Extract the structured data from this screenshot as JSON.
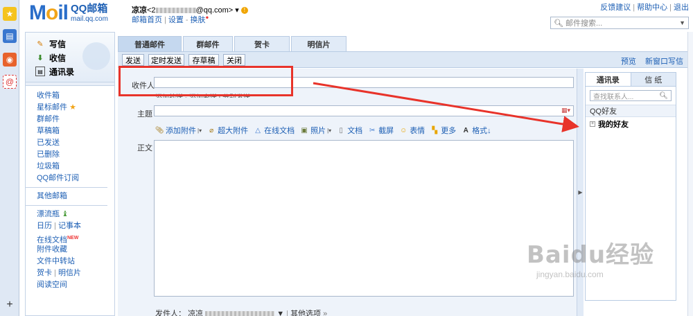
{
  "rail": {
    "icons": [
      "star-icon",
      "note-icon",
      "weibo-icon",
      "at-icon"
    ],
    "add_label": "+"
  },
  "header": {
    "logo_letters": [
      "M",
      "o",
      "il"
    ],
    "logo_cn": "QQ邮箱",
    "logo_url": "mail.qq.com",
    "user_name": "凉凉",
    "email_prefix": "<2",
    "email_suffix": "@qq.com>",
    "links": [
      "邮箱首页",
      "设置",
      "换肤"
    ],
    "top_links": [
      "反馈建议",
      "帮助中心",
      "退出"
    ],
    "search_placeholder": "邮件搜索..."
  },
  "leftnav": {
    "ops": [
      {
        "label": "写信",
        "icon": "pencil-icon"
      },
      {
        "label": "收信",
        "icon": "inbox-download-icon"
      },
      {
        "label": "通讯录",
        "icon": "address-book-icon"
      }
    ],
    "folders_group1": [
      "收件箱",
      "星标邮件",
      "群邮件",
      "草稿箱",
      "已发送",
      "已删除",
      "垃圾箱",
      "QQ邮件订阅"
    ],
    "folders_group2": [
      "其他邮箱"
    ],
    "folders_group3": [
      "漂流瓶",
      "日历",
      "记事本",
      "在线文档",
      "附件收藏",
      "文件中转站",
      "贺卡",
      "明信片",
      "阅读空间"
    ],
    "new_tag": "NEW"
  },
  "tabs": [
    "普通邮件",
    "群邮件",
    "贺卡",
    "明信片"
  ],
  "toolbar": {
    "buttons": [
      "发送",
      "定时发送",
      "存草稿",
      "关闭"
    ],
    "right_links": [
      "预览",
      "新窗口写信"
    ]
  },
  "compose": {
    "to_label": "收件人",
    "to_hint": "添加抄送 - 添加密送 | 分别发送",
    "subject_label": "主题",
    "body_label": "正文",
    "attach_items": [
      "添加附件",
      "超大附件",
      "在线文档",
      "照片",
      "文档",
      "截屏",
      "表情",
      "更多",
      "格式↓"
    ],
    "sender_label": "发件人：",
    "sender_name": "凉凉",
    "other_options": "其他选项"
  },
  "contacts": {
    "tabs": [
      "通讯录",
      "信 纸"
    ],
    "search_placeholder": "查找联系人...",
    "group": "QQ好友",
    "items": [
      "我的好友"
    ]
  },
  "watermark": {
    "main": "Baidu经验",
    "sub": "jingyan.baidu.com"
  },
  "colors": {
    "brand_blue": "#2a6ec9",
    "annotation_red": "#e8332a"
  }
}
